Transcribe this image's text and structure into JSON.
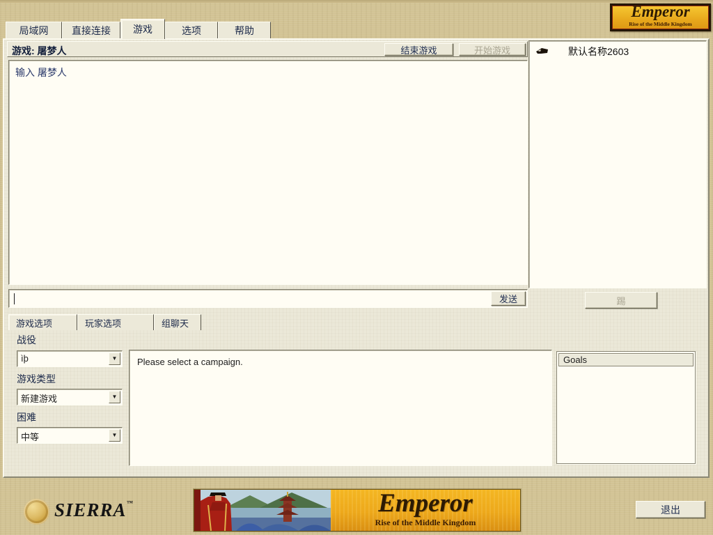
{
  "logo": {
    "title": "Emperor",
    "subtitle": "Rise of the Middle Kingdom"
  },
  "tabs": [
    {
      "label": "局域网"
    },
    {
      "label": "直接连接"
    },
    {
      "label": "游戏"
    },
    {
      "label": "选项"
    },
    {
      "label": "帮助"
    }
  ],
  "game": {
    "header_title": "游戏: 屠梦人",
    "end_game_button": "结束游戏",
    "start_game_button": "开始游戏",
    "chat_log_line": "输入 屠梦人",
    "chat_input_value": "",
    "send_button": "发送",
    "kick_button": "踢",
    "players": [
      {
        "name": "默认名称2603"
      }
    ]
  },
  "options_tabs": [
    {
      "label": "游戏选项"
    },
    {
      "label": "玩家选项"
    },
    {
      "label": "组聊天"
    }
  ],
  "game_options": {
    "campaign_label": "战役",
    "campaign_value": "ìþ",
    "game_type_label": "游戏类型",
    "game_type_value": "新建游戏",
    "difficulty_label": "困难",
    "difficulty_value": "中等",
    "description": "Please select a campaign.",
    "goals_title": "Goals"
  },
  "footer": {
    "sierra": "SIERRA",
    "sierra_tm": "™",
    "banner_title": "Emperor",
    "banner_subtitle": "Rise of the Middle Kingdom",
    "exit_button": "退出"
  },
  "colors": {
    "background": "#d2c394",
    "panel_face": "#ebe8d8",
    "gold": "#eda81b",
    "text_navy": "#1d2a4a",
    "disabled_text": "#a9a592"
  }
}
